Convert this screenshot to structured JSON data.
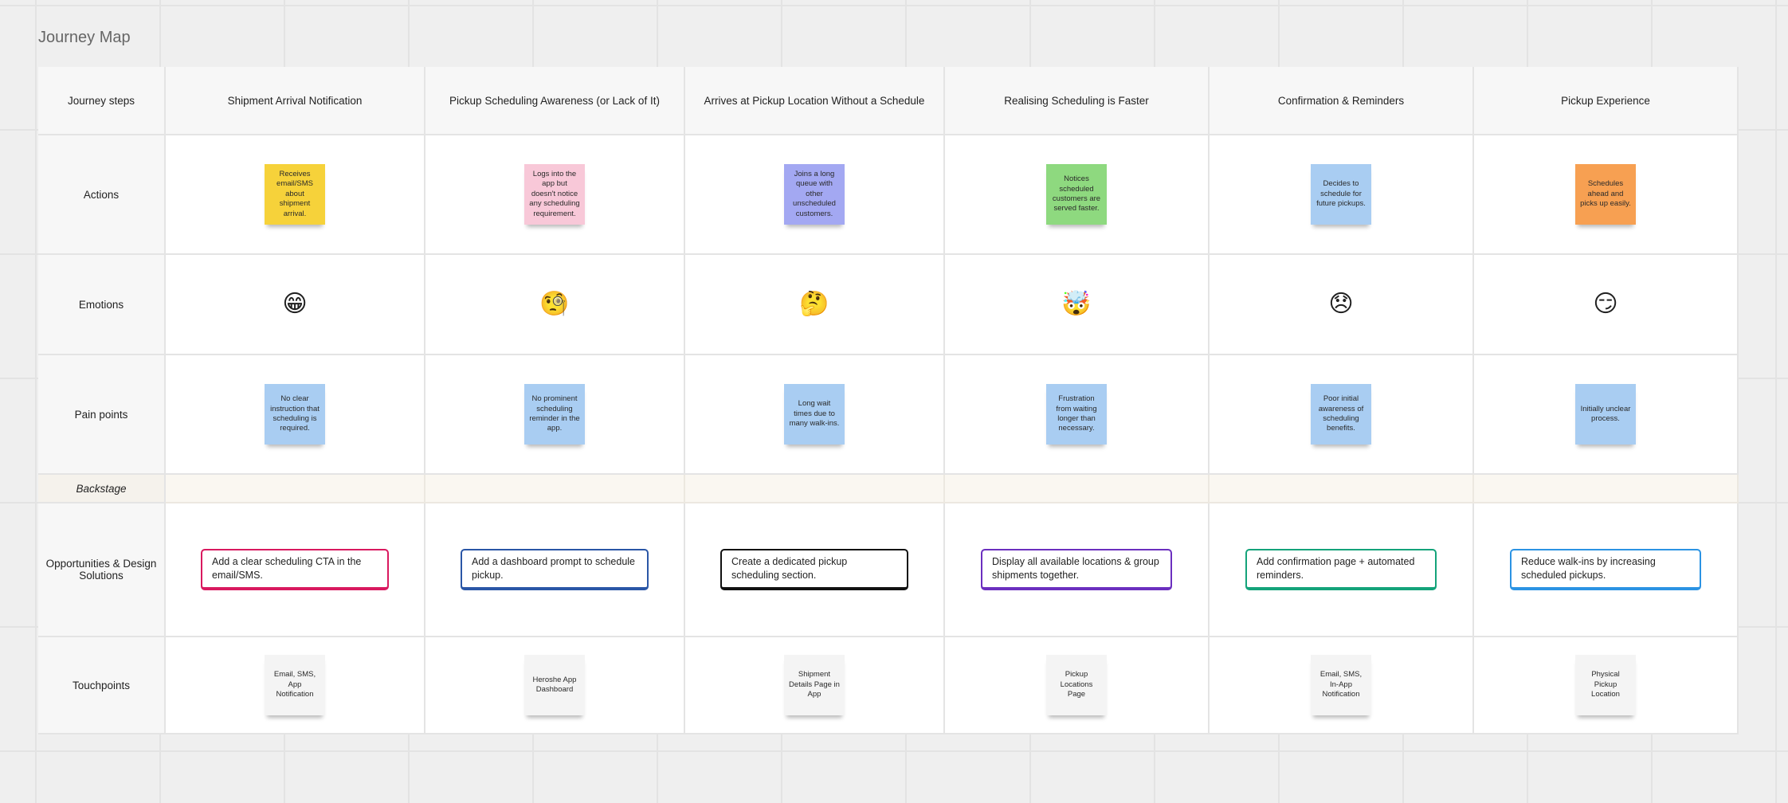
{
  "title": "Journey Map",
  "row_labels": {
    "steps": "Journey steps",
    "actions": "Actions",
    "emotions": "Emotions",
    "pain": "Pain points",
    "backstage": "Backstage",
    "opportunities": "Opportunities & Design Solutions",
    "touchpoints": "Touchpoints"
  },
  "stages": [
    {
      "step": "Shipment Arrival Notification",
      "action": "Receives email/SMS about shipment arrival.",
      "action_color": "#f6d23a",
      "emotion": "😁",
      "pain": "No clear instruction that scheduling is required.",
      "opportunity": "Add a clear scheduling CTA in the email/SMS.",
      "opportunity_color": "#d9195f",
      "touchpoint": "Email, SMS, App Notification"
    },
    {
      "step": "Pickup Scheduling Awareness (or Lack of It)",
      "action": "Logs into the app but doesn't notice any scheduling requirement.",
      "action_color": "#f8c8d8",
      "emotion": "🧐",
      "pain": "No prominent scheduling reminder in the app.",
      "opportunity": "Add a dashboard prompt to schedule pickup.",
      "opportunity_color": "#2a56a6",
      "touchpoint": "Heroshe App Dashboard"
    },
    {
      "step": "Arrives at Pickup Location Without a Schedule",
      "action": "Joins a long queue with other unscheduled customers.",
      "action_color": "#a3a8f2",
      "emotion": "🤔",
      "pain": "Long wait times due to many walk-ins.",
      "opportunity": "Create a dedicated pickup scheduling section.",
      "opportunity_color": "#111111",
      "touchpoint": "Shipment Details Page in App"
    },
    {
      "step": "Realising Scheduling is Faster",
      "action": "Notices scheduled customers are served faster.",
      "action_color": "#8ed97f",
      "emotion": "🤯",
      "pain": "Frustration from waiting longer than necessary.",
      "opportunity": "Display all available locations & group shipments together.",
      "opportunity_color": "#6b2fbf",
      "touchpoint": "Pickup Locations Page"
    },
    {
      "step": "Confirmation & Reminders",
      "action": "Decides to schedule for future pickups.",
      "action_color": "#a9cdf2",
      "emotion": "😞",
      "pain": "Poor initial awareness of scheduling benefits.",
      "opportunity": "Add confirmation page + automated reminders.",
      "opportunity_color": "#14a37a",
      "touchpoint": "Email, SMS, In-App Notification"
    },
    {
      "step": "Pickup Experience",
      "action": "Schedules ahead and picks up easily.",
      "action_color": "#f7a052",
      "emotion": "😏",
      "pain": "Initially unclear process.",
      "opportunity": "Reduce walk-ins by increasing scheduled pickups.",
      "opportunity_color": "#2b93e3",
      "touchpoint": "Physical Pickup Location"
    }
  ],
  "pain_color": "#a9cdf2",
  "touch_color": "#f4f4f4"
}
